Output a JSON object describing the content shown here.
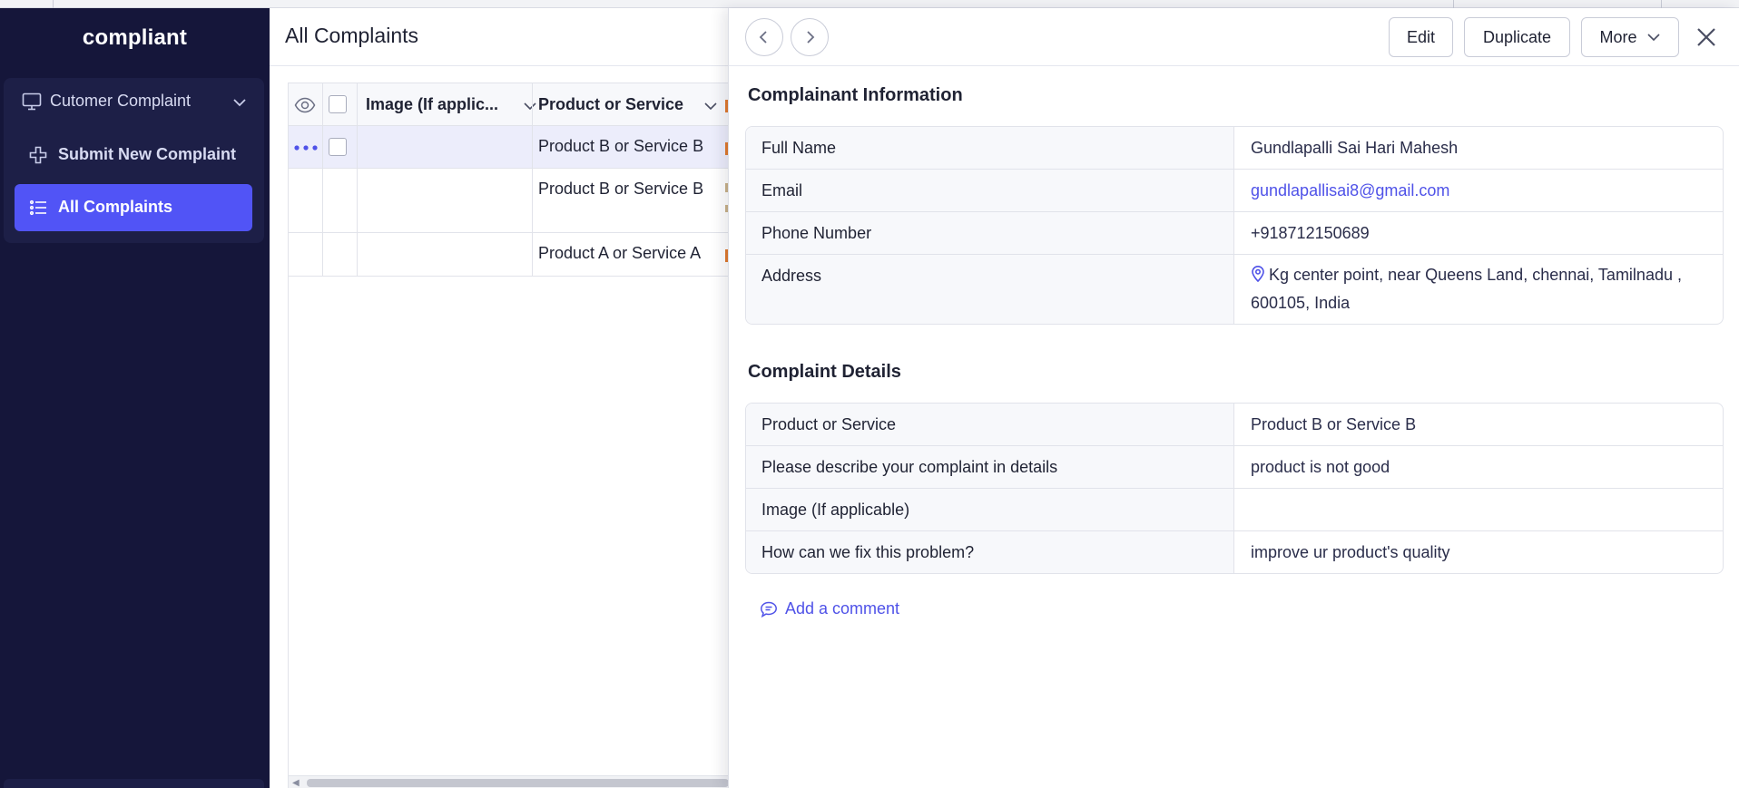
{
  "sidebar": {
    "brand": "compliant",
    "group": {
      "label": "Cutomer Complaint",
      "icon": "monitor-icon"
    },
    "items": [
      {
        "label": "Submit New Complaint",
        "icon": "plus-icon",
        "active": false
      },
      {
        "label": "All Complaints",
        "icon": "list-icon",
        "active": true
      }
    ]
  },
  "main": {
    "title": "All Complaints",
    "columns": [
      {
        "label": "Image (If applic..."
      },
      {
        "label": "Product or Service"
      }
    ],
    "rows": [
      {
        "product": "Product B or Service B",
        "selected": true
      },
      {
        "product": "Product B or Service B",
        "selected": false
      },
      {
        "product": "Product A or Service A",
        "selected": false
      }
    ]
  },
  "panel": {
    "toolbar": {
      "edit": "Edit",
      "duplicate": "Duplicate",
      "more": "More"
    },
    "complainant": {
      "title": "Complainant Information",
      "fields": [
        {
          "label": "Full Name",
          "value": "Gundlapalli Sai Hari Mahesh"
        },
        {
          "label": "Email",
          "value": "gundlapallisai8@gmail.com"
        },
        {
          "label": "Phone Number",
          "value": "+918712150689"
        },
        {
          "label": "Address",
          "value": "Kg center point, near Queens Land, chennai, Tamilnadu , 600105, India"
        }
      ]
    },
    "details": {
      "title": "Complaint Details",
      "fields": [
        {
          "label": "Product or Service",
          "value": "Product B or Service B"
        },
        {
          "label": "Please describe your complaint in details",
          "value": "product is not good"
        },
        {
          "label": "Image (If applicable)",
          "value": ""
        },
        {
          "label": "How can we fix this problem?",
          "value": "improve ur product's quality"
        }
      ]
    },
    "add_comment": "Add a comment"
  },
  "colors": {
    "sidebar_bg": "#15163a",
    "sidebar_card": "#1d1f47",
    "accent": "#5154f6",
    "link": "#4f52e8"
  }
}
